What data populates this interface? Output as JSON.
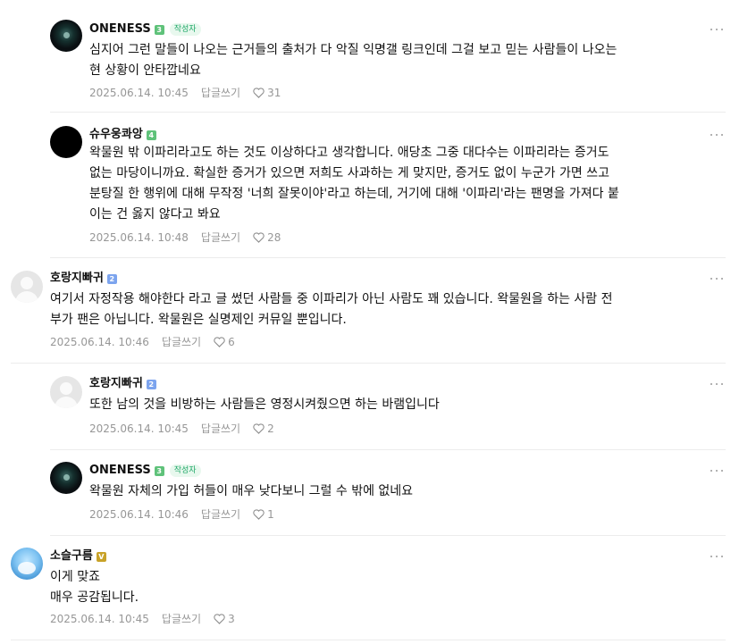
{
  "comments": [
    {
      "author": "ONENESS",
      "level": "3",
      "badge": "작성자",
      "text": "심지어 그런 말들이 나오는 근거들의 출처가 다 악질 익명갤 링크인데 그걸 보고 믿는 사람들이 나오는\n현 상황이 안타깝네요",
      "date": "2025.06.14. 10:45",
      "reply_label": "답글쓰기",
      "likes": "31"
    },
    {
      "author": "슈우웅콰앙",
      "level": "4",
      "text": "왁물원 밖 이파리라고도 하는 것도 이상하다고 생각합니다. 애당초 그중 대다수는 이파리라는 증거도\n없는 마당이니까요. 확실한 증거가 있으면 저희도 사과하는 게 맞지만, 증거도 없이 누군가 가면 쓰고\n분탕질 한 행위에 대해 무작정 '너희 잘못이야'라고 하는데, 거기에 대해 '이파리'라는 팬명을 가져다 붙\n이는 건 옳지 않다고 봐요",
      "date": "2025.06.14. 10:48",
      "reply_label": "답글쓰기",
      "likes": "28"
    },
    {
      "author": "호랑지빠귀",
      "level": "2",
      "text": "여기서 자정작용 해야한다 라고 글 썼던 사람들 중 이파리가 아닌 사람도 꽤 있습니다. 왁물원을 하는 사람 전\n부가 팬은 아닙니다. 왁물원은 실명제인 커뮤일 뿐입니다.",
      "date": "2025.06.14. 10:46",
      "reply_label": "답글쓰기",
      "likes": "6"
    },
    {
      "author": "호랑지빠귀",
      "level": "2",
      "text": "또한 남의 것을 비방하는 사람들은 영정시켜줬으면 하는 바램입니다",
      "date": "2025.06.14. 10:45",
      "reply_label": "답글쓰기",
      "likes": "2"
    },
    {
      "author": "ONENESS",
      "level": "3",
      "badge": "작성자",
      "text": "왁물원 자체의 가입 허들이 매우 낮다보니 그럴 수 밖에 없네요",
      "date": "2025.06.14. 10:46",
      "reply_label": "답글쓰기",
      "likes": "1"
    },
    {
      "author": "소슬구름",
      "level": "V",
      "text": "이게 맞죠\n매우 공감됩니다.",
      "date": "2025.06.14. 10:45",
      "reply_label": "답글쓰기",
      "likes": "3"
    }
  ],
  "colors": {
    "accent": "#20a868",
    "meta": "#979797",
    "divider": "#ececec"
  },
  "icons": {
    "like": "heart-icon",
    "more": "more-options-icon"
  }
}
